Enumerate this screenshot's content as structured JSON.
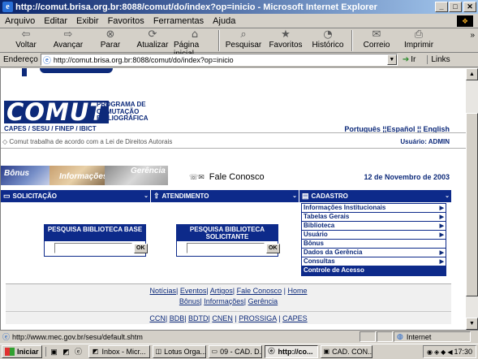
{
  "window": {
    "title": "http://comut.brisa.org.br:8088/comut/do/index?op=inicio - Microsoft Internet Explorer"
  },
  "menu": [
    "Arquivo",
    "Editar",
    "Exibir",
    "Favoritos",
    "Ferramentas",
    "Ajuda"
  ],
  "toolbar": {
    "buttons": [
      "Voltar",
      "Avançar",
      "Parar",
      "Atualizar",
      "Página inicial",
      "Pesquisar",
      "Favoritos",
      "Histórico",
      "Correio",
      "Imprimir"
    ]
  },
  "address": {
    "label": "Endereço",
    "url": "http://comut.brisa.org.br:8088/comut/do/index?op=inicio",
    "go": "Ir",
    "links": "Links"
  },
  "page": {
    "logo": {
      "word": "COMUT",
      "program": "PROGRAMA DE COMUTAÇÃO BIBLIOGRÁFICA",
      "partners": "CAPES / SESU / FINEP / IBICT"
    },
    "languages": "Português ¦¦Español ¦¦ English",
    "info": "◇ Comut trabalha de acordo com a Lei de Direitos Autorais",
    "user": "Usuário: ADMIN",
    "image_buttons": [
      "Bônus",
      "Informações",
      "Gerência"
    ],
    "contact": "Fale Conosco",
    "date": "12 de Novembro de 2003",
    "menubar": [
      {
        "label": "SOLICITAÇÃO"
      },
      {
        "label": "ATENDIMENTO"
      },
      {
        "label": "CADASTRO"
      }
    ],
    "dropdown": [
      {
        "label": "Informações Institucionais",
        "submenu": true
      },
      {
        "label": "Tabelas Gerais",
        "submenu": true
      },
      {
        "label": "Biblioteca",
        "submenu": true
      },
      {
        "label": "Usuário",
        "submenu": true
      },
      {
        "label": "Bônus",
        "submenu": false
      },
      {
        "label": "Dados da Gerência",
        "submenu": true
      },
      {
        "label": "Consultas",
        "submenu": true
      },
      {
        "label": "Controle de Acesso",
        "submenu": false,
        "selected": true
      }
    ],
    "search_base": {
      "title": "PESQUISA BIBLIOTECA BASE",
      "ok": "OK"
    },
    "search_solicitante": {
      "title": "PESQUISA BIBLIOTECA SOLICITANTE",
      "ok": "OK"
    },
    "footer": {
      "line1": [
        "Notícias",
        "Eventos",
        "Artigos",
        "Fale Conosco",
        "Home"
      ],
      "line2": [
        "Bônus",
        "Informações",
        "Gerência"
      ],
      "line3": [
        "CCN",
        "BDB",
        "BDTD",
        "CNEN",
        "PROSSIGA",
        "CAPES"
      ]
    }
  },
  "status": {
    "text": "http://www.mec.gov.br/sesu/default.shtm",
    "zone": "Internet"
  },
  "taskbar": {
    "start": "Iniciar",
    "tasks": [
      {
        "label": "Inbox - Micr..."
      },
      {
        "label": "Lotus Orga..."
      },
      {
        "label": "09 - CAD. D..."
      },
      {
        "label": "http://co...",
        "active": true
      },
      {
        "label": "CAD. CON..."
      }
    ],
    "clock": "17:30"
  }
}
